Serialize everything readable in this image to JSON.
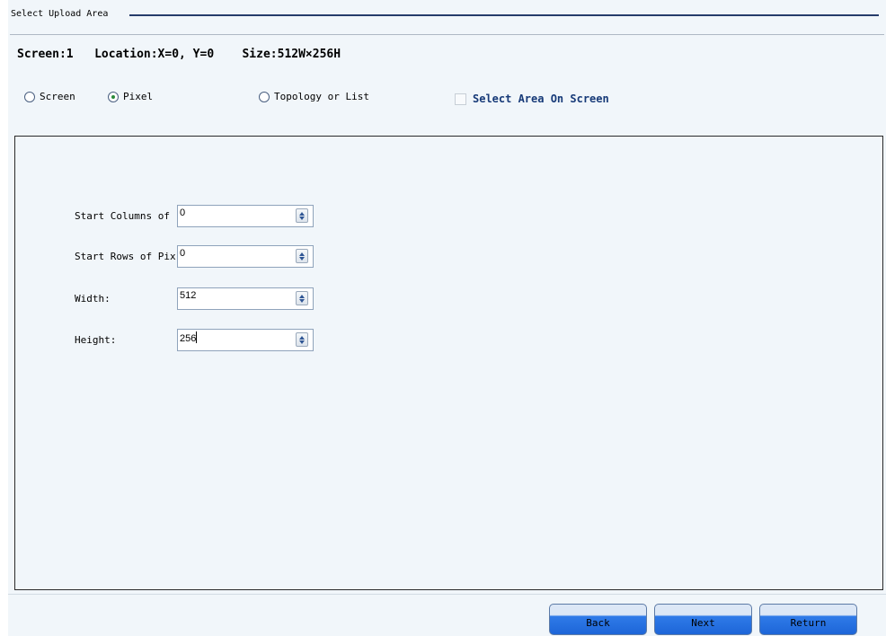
{
  "group": {
    "title": "Select Upload Area"
  },
  "info": {
    "screen": "Screen:1",
    "location": "Location:X=0, Y=0",
    "size": "Size:512W×256H"
  },
  "options": {
    "screen_label": "Screen",
    "pixel_label": "Pixel",
    "topology_label": "Topology or List",
    "select_area_label": "Select Area On Screen",
    "selected": "Pixel"
  },
  "fields": [
    {
      "label": "Start Columns of Pixel",
      "value": "0"
    },
    {
      "label": "Start Rows of Pixel",
      "value": "0"
    },
    {
      "label": "Width:",
      "value": "512"
    },
    {
      "label": "Height:",
      "value": "256"
    }
  ],
  "buttons": {
    "back": "Back",
    "next": "Next",
    "return": "Return"
  }
}
